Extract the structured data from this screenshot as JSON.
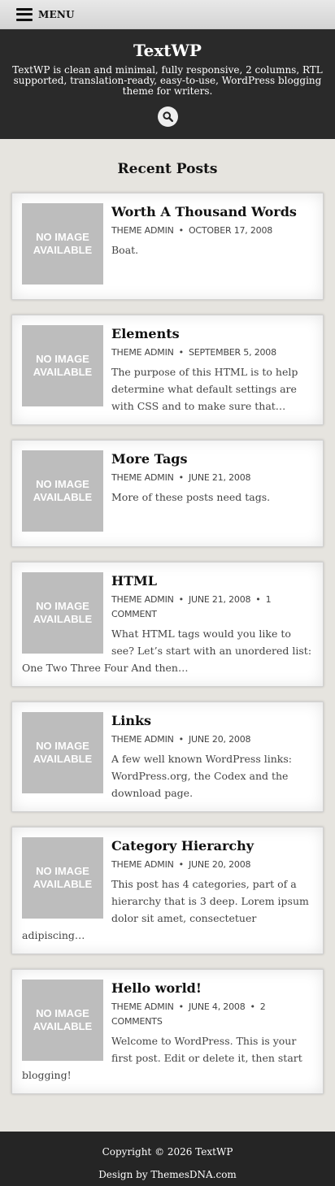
{
  "menu": {
    "label": "MENU"
  },
  "header": {
    "title": "TextWP",
    "description": "TextWP is clean and minimal, fully responsive, 2 columns, RTL supported, translation-ready, easy-to-use, WordPress blogging theme for writers.",
    "search_icon": "search-icon"
  },
  "section": {
    "title": "Recent Posts"
  },
  "thumb_placeholder": "NO IMAGE AVAILABLE",
  "posts": [
    {
      "title": "Worth A Thousand Words",
      "author": "THEME ADMIN",
      "date": "OCTOBER 17, 2008",
      "comments": "",
      "excerpt": "Boat."
    },
    {
      "title": "Elements",
      "author": "THEME ADMIN",
      "date": "SEPTEMBER 5, 2008",
      "comments": "",
      "excerpt": "The purpose of this HTML is to help determine what default settings are with CSS and to make sure that…"
    },
    {
      "title": "More Tags",
      "author": "THEME ADMIN",
      "date": "JUNE 21, 2008",
      "comments": "",
      "excerpt": "More of these posts need tags."
    },
    {
      "title": "HTML",
      "author": "THEME ADMIN",
      "date": "JUNE 21, 2008",
      "comments": "1 COMMENT",
      "excerpt": "What HTML tags would you like to see? Let’s start with an unordered list: One Two Three Four And then…"
    },
    {
      "title": "Links",
      "author": "THEME ADMIN",
      "date": "JUNE 20, 2008",
      "comments": "",
      "excerpt": "A few well known WordPress links: WordPress.org, the Codex and the download page."
    },
    {
      "title": "Category Hierarchy",
      "author": "THEME ADMIN",
      "date": "JUNE 20, 2008",
      "comments": "",
      "excerpt": "This post has 4 categories, part of a hierarchy that is 3 deep. Lorem ipsum dolor sit amet, consectetuer adipiscing…"
    },
    {
      "title": "Hello world!",
      "author": "THEME ADMIN",
      "date": "JUNE 4, 2008",
      "comments": "2 COMMENTS",
      "excerpt": "Welcome to WordPress. This is your first post. Edit or delete it, then start blogging!"
    }
  ],
  "footer": {
    "copyright": "Copyright © 2026 TextWP",
    "credit": "Design by ThemesDNA.com"
  },
  "colors": {
    "header_bg": "#2a2a2a",
    "page_bg": "#e6e4df",
    "thumb_bg": "#bdbdbd"
  }
}
